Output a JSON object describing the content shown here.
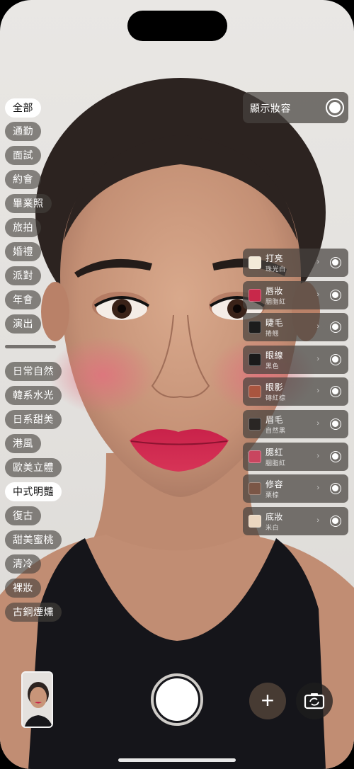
{
  "categories": {
    "occasion": [
      "全部",
      "通勤",
      "面試",
      "約會",
      "畢業照",
      "旅拍",
      "婚禮",
      "派對",
      "年會",
      "演出"
    ],
    "style": [
      "日常自然",
      "韓系水光",
      "日系甜美",
      "港風",
      "歐美立體",
      "中式明豔",
      "復古",
      "甜美蜜桃",
      "清冷",
      "裸妝",
      "古銅煙燻"
    ],
    "active_occasion": "全部",
    "active_style": "中式明豔"
  },
  "show_makeup": {
    "label": "顯示妝容",
    "enabled": true
  },
  "makeup_items": [
    {
      "name": "打亮",
      "shade": "珠光白",
      "swatch": "#f3ead8"
    },
    {
      "name": "唇妝",
      "shade": "胭脂紅",
      "swatch": "#c8284a"
    },
    {
      "name": "睫毛",
      "shade": "捲翹",
      "swatch": "#1c1c1c"
    },
    {
      "name": "眼線",
      "shade": "黑色",
      "swatch": "#1a1a1a"
    },
    {
      "name": "眼影",
      "shade": "磚紅棕",
      "swatch": "#a9553f"
    },
    {
      "name": "眉毛",
      "shade": "自然黑",
      "swatch": "#2a2624"
    },
    {
      "name": "腮紅",
      "shade": "胭脂紅",
      "swatch": "#c9455f"
    },
    {
      "name": "修容",
      "shade": "栗棕",
      "swatch": "#7b5646"
    },
    {
      "name": "底妝",
      "shade": "米白",
      "swatch": "#ecd7c0"
    }
  ],
  "controls": {
    "add_label": "+",
    "chevron": "›",
    "icons": [
      "photo-thumbnail",
      "shutter",
      "plus-icon",
      "camera-flip-icon"
    ]
  }
}
